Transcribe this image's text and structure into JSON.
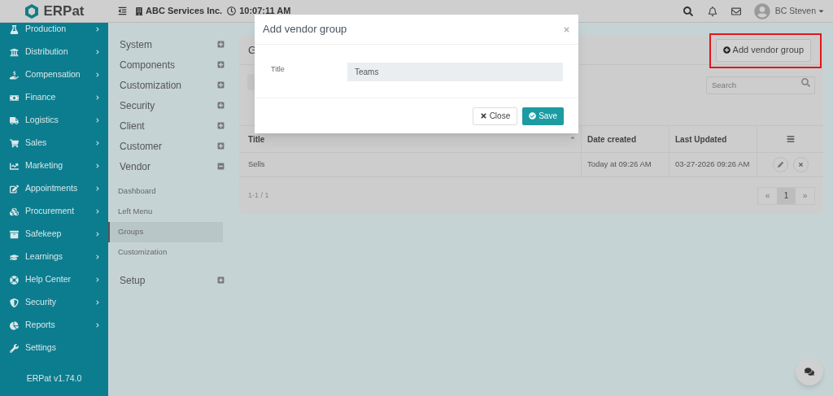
{
  "header": {
    "logo": "ERPat",
    "company": "ABC Services Inc.",
    "time": "10:07:11 AM",
    "user": "BC Steven"
  },
  "sidebar": {
    "items": [
      {
        "label": "Production",
        "has_arrow": true
      },
      {
        "label": "Distribution",
        "has_arrow": true
      },
      {
        "label": "Compensation",
        "has_arrow": true
      },
      {
        "label": "Finance",
        "has_arrow": true
      },
      {
        "label": "Logistics",
        "has_arrow": true
      },
      {
        "label": "Sales",
        "has_arrow": true
      },
      {
        "label": "Marketing",
        "has_arrow": true
      },
      {
        "label": "Appointments",
        "has_arrow": true
      },
      {
        "label": "Procurement",
        "has_arrow": true
      },
      {
        "label": "Safekeep",
        "has_arrow": true
      },
      {
        "label": "Learnings",
        "has_arrow": true
      },
      {
        "label": "Help Center",
        "has_arrow": true
      },
      {
        "label": "Security",
        "has_arrow": true
      },
      {
        "label": "Reports",
        "has_arrow": true
      },
      {
        "label": "Settings",
        "has_arrow": false
      }
    ],
    "version": "ERPat v1.74.0"
  },
  "settings_menu": {
    "groups": [
      {
        "label": "System",
        "expanded": false
      },
      {
        "label": "Components",
        "expanded": false
      },
      {
        "label": "Customization",
        "expanded": false
      },
      {
        "label": "Security",
        "expanded": false
      },
      {
        "label": "Client",
        "expanded": false
      },
      {
        "label": "Customer",
        "expanded": false
      },
      {
        "label": "Vendor",
        "expanded": true,
        "children": [
          {
            "label": "Dashboard",
            "selected": false
          },
          {
            "label": "Left Menu",
            "selected": false
          },
          {
            "label": "Groups",
            "selected": true
          },
          {
            "label": "Customization",
            "selected": false
          }
        ]
      },
      {
        "label": "Setup",
        "expanded": false
      }
    ]
  },
  "card": {
    "title": "G",
    "add_button": "Add vendor group",
    "search": {
      "placeholder": "Search"
    },
    "table": {
      "columns": [
        "Title",
        "Date created",
        "Last Updated"
      ],
      "rows": [
        {
          "title": "Sells",
          "date_created": "Today at 09:26 AM",
          "last_updated": "03-27-2026 09:26 AM"
        }
      ]
    },
    "range": "1-1 / 1",
    "pagination": [
      {
        "label": "«",
        "selected": false
      },
      {
        "label": "1",
        "selected": true
      },
      {
        "label": "»",
        "selected": false
      }
    ]
  },
  "modal": {
    "title": "Add vendor group",
    "field_label": "Title",
    "field_value": "Teams",
    "buttons": [
      {
        "label": "Close",
        "kind": "default"
      },
      {
        "label": "Save",
        "kind": "primary"
      }
    ]
  }
}
